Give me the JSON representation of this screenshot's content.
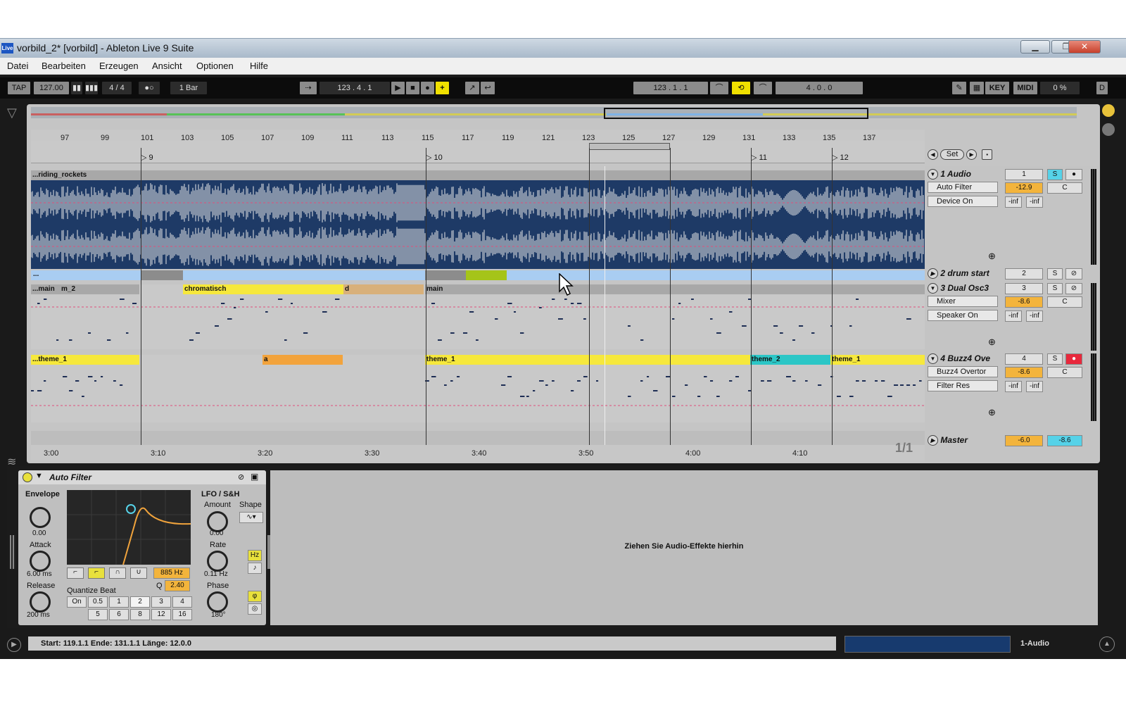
{
  "window": {
    "title": "vorbild_2*  [vorbild] - Ableton Live 9 Suite",
    "app_icon": "Live",
    "min": "▁",
    "max": "❐",
    "close": "✕"
  },
  "menu": [
    "Datei",
    "Bearbeiten",
    "Erzeugen",
    "Ansicht",
    "Optionen",
    "Hilfe"
  ],
  "control": {
    "tap": "TAP",
    "tempo": "127.00",
    "sig": "4 / 4",
    "quant": "1 Bar",
    "position": "123 .   4 .   1",
    "loop_start": "123 .   1 .   1",
    "loop_len": "4 .   0 .   0",
    "key": "KEY",
    "midi": "MIDI",
    "cpu": "0 %",
    "d": "D"
  },
  "ruler_ticks": [
    "97",
    "99",
    "101",
    "103",
    "105",
    "107",
    "109",
    "111",
    "113",
    "115",
    "117",
    "119",
    "121",
    "123",
    "125",
    "127",
    "129",
    "131",
    "133",
    "135",
    "137"
  ],
  "locators": [
    "9",
    "10",
    "11",
    "12"
  ],
  "time_ticks": [
    "3:00",
    "3:10",
    "3:20",
    "3:30",
    "3:40",
    "3:50",
    "4:00",
    "4:10"
  ],
  "clips": {
    "audio": "...riding_rockets",
    "drum_start": "...",
    "osc": [
      "...main",
      "m_2",
      "chromatisch",
      "d",
      "main"
    ],
    "buzz": [
      "...theme_1",
      "a",
      "theme_1",
      "theme_2",
      "theme_1"
    ]
  },
  "set_label": "Set",
  "tracks": [
    {
      "name": "1 Audio",
      "num": "1",
      "device": "Auto Filter",
      "chooser": "Device On",
      "vol": "-12.9",
      "pan": "C",
      "inf1": "-inf",
      "inf2": "-inf"
    },
    {
      "name": "2 drum start",
      "num": "2"
    },
    {
      "name": "3 Dual Osc3",
      "num": "3",
      "device": "Mixer",
      "chooser": "Speaker On",
      "vol": "-8.6",
      "pan": "C",
      "inf1": "-inf",
      "inf2": "-inf"
    },
    {
      "name": "4 Buzz4 Ove",
      "num": "4",
      "device": "Buzz4 Overtor",
      "chooser": "Filter Res",
      "vol": "-8.6",
      "pan": "C",
      "inf1": "-inf",
      "inf2": "-inf"
    }
  ],
  "solo": "S",
  "master": {
    "name": "Master",
    "vol": "-6.0",
    "cue": "-8.6",
    "ratio": "1/1"
  },
  "device": {
    "title": "Auto Filter",
    "envelope": "Envelope",
    "env_val": "0.00",
    "attack": "Attack",
    "attack_val": "6.00 ms",
    "release": "Release",
    "release_val": "200 ms",
    "freq": "885 Hz",
    "q": "Q",
    "q_val": "2.40",
    "quantize": "Quantize Beat",
    "q_buttons": [
      "On",
      "0.5",
      "1",
      "2",
      "3",
      "4"
    ],
    "q_buttons2": [
      "5",
      "6",
      "8",
      "12",
      "16"
    ],
    "lfo": "LFO / S&H",
    "amount": "Amount",
    "shape": "Shape",
    "amount_val": "0.00",
    "rate": "Rate",
    "rate_val": "0.11 Hz",
    "hz": "Hz",
    "phase": "Phase",
    "phase_val": "180°"
  },
  "drop_hint": "Ziehen Sie Audio-Effekte hierhin",
  "status": {
    "text": "Start: 119.1.1  Ende: 131.1.1  Länge: 12.0.0",
    "track": "1-Audio"
  },
  "colors": {
    "clip_yellow": "#f6e83c",
    "clip_orange": "#f2a33c",
    "clip_blue": "#a9cdf2",
    "clip_cyan": "#2bc6c6",
    "waveform": "#1e3a66"
  }
}
